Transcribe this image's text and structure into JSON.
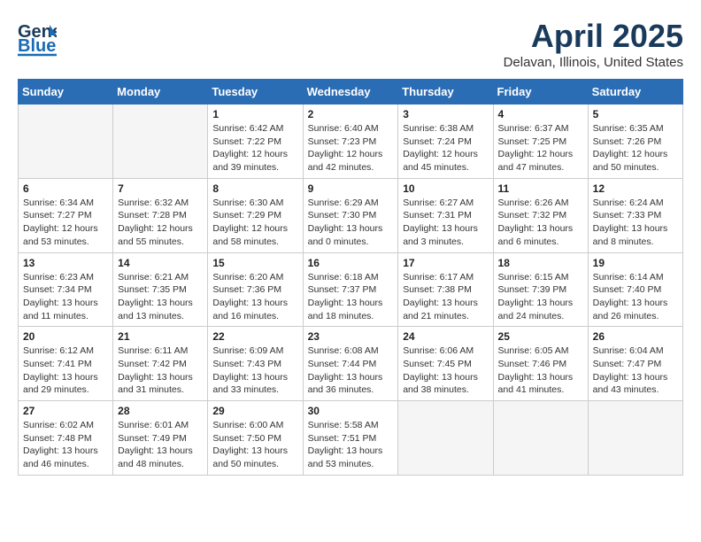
{
  "header": {
    "logo_line1": "General",
    "logo_line2": "Blue",
    "title": "April 2025",
    "subtitle": "Delavan, Illinois, United States"
  },
  "weekdays": [
    "Sunday",
    "Monday",
    "Tuesday",
    "Wednesday",
    "Thursday",
    "Friday",
    "Saturday"
  ],
  "weeks": [
    [
      {
        "day": "",
        "empty": true
      },
      {
        "day": "",
        "empty": true
      },
      {
        "day": "1",
        "sunrise": "Sunrise: 6:42 AM",
        "sunset": "Sunset: 7:22 PM",
        "daylight": "Daylight: 12 hours and 39 minutes."
      },
      {
        "day": "2",
        "sunrise": "Sunrise: 6:40 AM",
        "sunset": "Sunset: 7:23 PM",
        "daylight": "Daylight: 12 hours and 42 minutes."
      },
      {
        "day": "3",
        "sunrise": "Sunrise: 6:38 AM",
        "sunset": "Sunset: 7:24 PM",
        "daylight": "Daylight: 12 hours and 45 minutes."
      },
      {
        "day": "4",
        "sunrise": "Sunrise: 6:37 AM",
        "sunset": "Sunset: 7:25 PM",
        "daylight": "Daylight: 12 hours and 47 minutes."
      },
      {
        "day": "5",
        "sunrise": "Sunrise: 6:35 AM",
        "sunset": "Sunset: 7:26 PM",
        "daylight": "Daylight: 12 hours and 50 minutes."
      }
    ],
    [
      {
        "day": "6",
        "sunrise": "Sunrise: 6:34 AM",
        "sunset": "Sunset: 7:27 PM",
        "daylight": "Daylight: 12 hours and 53 minutes."
      },
      {
        "day": "7",
        "sunrise": "Sunrise: 6:32 AM",
        "sunset": "Sunset: 7:28 PM",
        "daylight": "Daylight: 12 hours and 55 minutes."
      },
      {
        "day": "8",
        "sunrise": "Sunrise: 6:30 AM",
        "sunset": "Sunset: 7:29 PM",
        "daylight": "Daylight: 12 hours and 58 minutes."
      },
      {
        "day": "9",
        "sunrise": "Sunrise: 6:29 AM",
        "sunset": "Sunset: 7:30 PM",
        "daylight": "Daylight: 13 hours and 0 minutes."
      },
      {
        "day": "10",
        "sunrise": "Sunrise: 6:27 AM",
        "sunset": "Sunset: 7:31 PM",
        "daylight": "Daylight: 13 hours and 3 minutes."
      },
      {
        "day": "11",
        "sunrise": "Sunrise: 6:26 AM",
        "sunset": "Sunset: 7:32 PM",
        "daylight": "Daylight: 13 hours and 6 minutes."
      },
      {
        "day": "12",
        "sunrise": "Sunrise: 6:24 AM",
        "sunset": "Sunset: 7:33 PM",
        "daylight": "Daylight: 13 hours and 8 minutes."
      }
    ],
    [
      {
        "day": "13",
        "sunrise": "Sunrise: 6:23 AM",
        "sunset": "Sunset: 7:34 PM",
        "daylight": "Daylight: 13 hours and 11 minutes."
      },
      {
        "day": "14",
        "sunrise": "Sunrise: 6:21 AM",
        "sunset": "Sunset: 7:35 PM",
        "daylight": "Daylight: 13 hours and 13 minutes."
      },
      {
        "day": "15",
        "sunrise": "Sunrise: 6:20 AM",
        "sunset": "Sunset: 7:36 PM",
        "daylight": "Daylight: 13 hours and 16 minutes."
      },
      {
        "day": "16",
        "sunrise": "Sunrise: 6:18 AM",
        "sunset": "Sunset: 7:37 PM",
        "daylight": "Daylight: 13 hours and 18 minutes."
      },
      {
        "day": "17",
        "sunrise": "Sunrise: 6:17 AM",
        "sunset": "Sunset: 7:38 PM",
        "daylight": "Daylight: 13 hours and 21 minutes."
      },
      {
        "day": "18",
        "sunrise": "Sunrise: 6:15 AM",
        "sunset": "Sunset: 7:39 PM",
        "daylight": "Daylight: 13 hours and 24 minutes."
      },
      {
        "day": "19",
        "sunrise": "Sunrise: 6:14 AM",
        "sunset": "Sunset: 7:40 PM",
        "daylight": "Daylight: 13 hours and 26 minutes."
      }
    ],
    [
      {
        "day": "20",
        "sunrise": "Sunrise: 6:12 AM",
        "sunset": "Sunset: 7:41 PM",
        "daylight": "Daylight: 13 hours and 29 minutes."
      },
      {
        "day": "21",
        "sunrise": "Sunrise: 6:11 AM",
        "sunset": "Sunset: 7:42 PM",
        "daylight": "Daylight: 13 hours and 31 minutes."
      },
      {
        "day": "22",
        "sunrise": "Sunrise: 6:09 AM",
        "sunset": "Sunset: 7:43 PM",
        "daylight": "Daylight: 13 hours and 33 minutes."
      },
      {
        "day": "23",
        "sunrise": "Sunrise: 6:08 AM",
        "sunset": "Sunset: 7:44 PM",
        "daylight": "Daylight: 13 hours and 36 minutes."
      },
      {
        "day": "24",
        "sunrise": "Sunrise: 6:06 AM",
        "sunset": "Sunset: 7:45 PM",
        "daylight": "Daylight: 13 hours and 38 minutes."
      },
      {
        "day": "25",
        "sunrise": "Sunrise: 6:05 AM",
        "sunset": "Sunset: 7:46 PM",
        "daylight": "Daylight: 13 hours and 41 minutes."
      },
      {
        "day": "26",
        "sunrise": "Sunrise: 6:04 AM",
        "sunset": "Sunset: 7:47 PM",
        "daylight": "Daylight: 13 hours and 43 minutes."
      }
    ],
    [
      {
        "day": "27",
        "sunrise": "Sunrise: 6:02 AM",
        "sunset": "Sunset: 7:48 PM",
        "daylight": "Daylight: 13 hours and 46 minutes."
      },
      {
        "day": "28",
        "sunrise": "Sunrise: 6:01 AM",
        "sunset": "Sunset: 7:49 PM",
        "daylight": "Daylight: 13 hours and 48 minutes."
      },
      {
        "day": "29",
        "sunrise": "Sunrise: 6:00 AM",
        "sunset": "Sunset: 7:50 PM",
        "daylight": "Daylight: 13 hours and 50 minutes."
      },
      {
        "day": "30",
        "sunrise": "Sunrise: 5:58 AM",
        "sunset": "Sunset: 7:51 PM",
        "daylight": "Daylight: 13 hours and 53 minutes."
      },
      {
        "day": "",
        "empty": true
      },
      {
        "day": "",
        "empty": true
      },
      {
        "day": "",
        "empty": true
      }
    ]
  ]
}
